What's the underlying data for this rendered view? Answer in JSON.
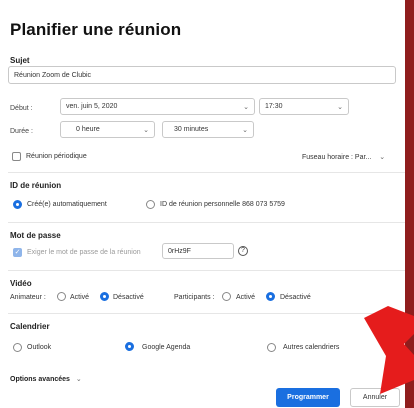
{
  "dialog": {
    "title": "Planifier une réunion"
  },
  "subject": {
    "label": "Sujet",
    "value": "Réunion Zoom de Clubic"
  },
  "start": {
    "label": "Début :",
    "date": "ven. juin 5, 2020",
    "time": "17:30"
  },
  "duration": {
    "label": "Durée :",
    "hours": "0 heure",
    "minutes": "30 minutes"
  },
  "recurring": {
    "label": "Réunion périodique",
    "checked": false
  },
  "timezone": {
    "label": "Fuseau horaire : Par..."
  },
  "meeting_id": {
    "heading": "ID de réunion",
    "auto_label": "Créé(e) automatiquement",
    "personal_label": "ID de réunion personnelle 868 073 5759",
    "selected": "auto"
  },
  "password": {
    "heading": "Mot de passe",
    "require_label": "Exiger le mot de passe de la réunion",
    "value": "0rHz9F",
    "checked": true
  },
  "video": {
    "heading": "Vidéo",
    "host_label": "Animateur :",
    "participants_label": "Participants :",
    "on_label": "Activé",
    "off_label": "Désactivé",
    "host": "off",
    "participants": "off"
  },
  "calendar": {
    "heading": "Calendrier",
    "options": [
      "Outlook",
      "Google Agenda",
      "Autres calendriers"
    ],
    "selected": "Google Agenda"
  },
  "advanced": {
    "label": "Options avancées"
  },
  "buttons": {
    "schedule": "Programmer",
    "cancel": "Annuler"
  },
  "colors": {
    "accent": "#1a6fe0",
    "background": "#8f1d1d",
    "arrow": "#e51c1c"
  }
}
